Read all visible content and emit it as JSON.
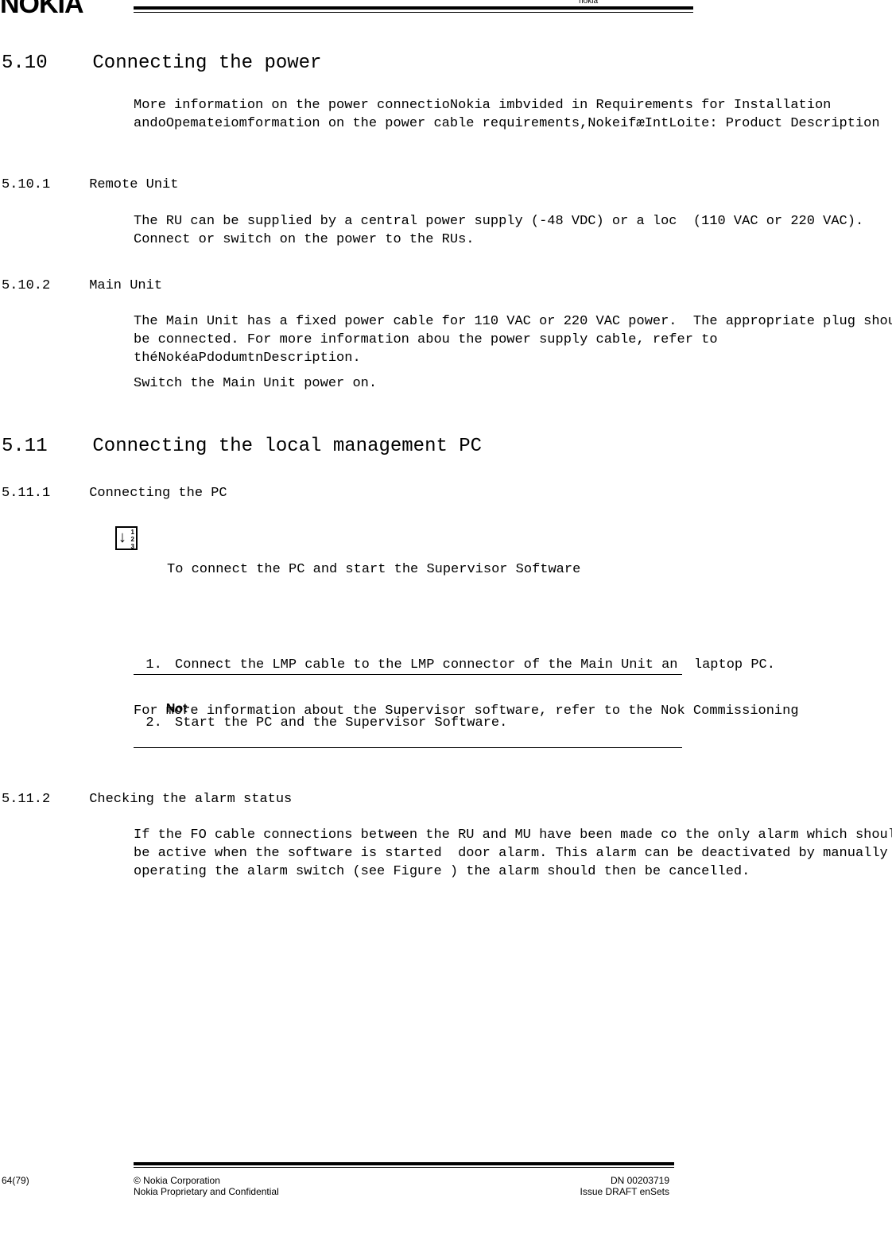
{
  "header": {
    "logo_alt": "NOKIA",
    "corner_note": "nokia"
  },
  "s510": {
    "num": "5.10",
    "title": "Connecting the power",
    "para": "More information on the power connectioNokia imbvided in Requirements for Installation andoOpemateiomformation on the power cable requirements,NokeifæIntLoite: Product Description"
  },
  "s5101": {
    "num": "5.10.1",
    "title": "Remote Unit",
    "para": "The RU can be supplied by a central power supply (-48 VDC) or a loc  (110 VAC or 220 VAC). Connect or switch on the power to the RUs."
  },
  "s5102": {
    "num": "5.10.2",
    "title": "Main Unit",
    "para1": "The Main Unit has a fixed power cable for 110 VAC or 220 VAC power.  The appropriate plug should be connected. For more information abou the power supply cable, refer to théNokéaPdodumtnDescription.",
    "para2": "Switch the Main Unit power on."
  },
  "s511": {
    "num": "5.11",
    "title": "Connecting the local management PC"
  },
  "s5111": {
    "num": "5.11.1",
    "title": "Connecting the PC",
    "lead": "To connect the PC and start the Supervisor Software",
    "steps": [
      "Connect the LMP cable to the LMP connector of the Main Unit an  laptop PC.",
      "Start the PC and the Supervisor Software."
    ],
    "note_label": "Not",
    "note_body": "For more information about the Supervisor software, refer to the Nok Commissioning"
  },
  "s5112": {
    "num": "5.11.2",
    "title": "Checking the alarm status",
    "para": "If the FO cable connections between the RU and MU have been made co the only alarm which should be active when the software is started  door alarm. This alarm can be deactivated by manually operating the alarm switch (see Figure ) the alarm should then be cancelled."
  },
  "footer": {
    "page": "64(79)",
    "copyright": "© Nokia Corporation",
    "conf": "Nokia Proprietary and Confidential",
    "dn": "DN 00203719",
    "issue": "Issue DRAFT  enSets"
  }
}
